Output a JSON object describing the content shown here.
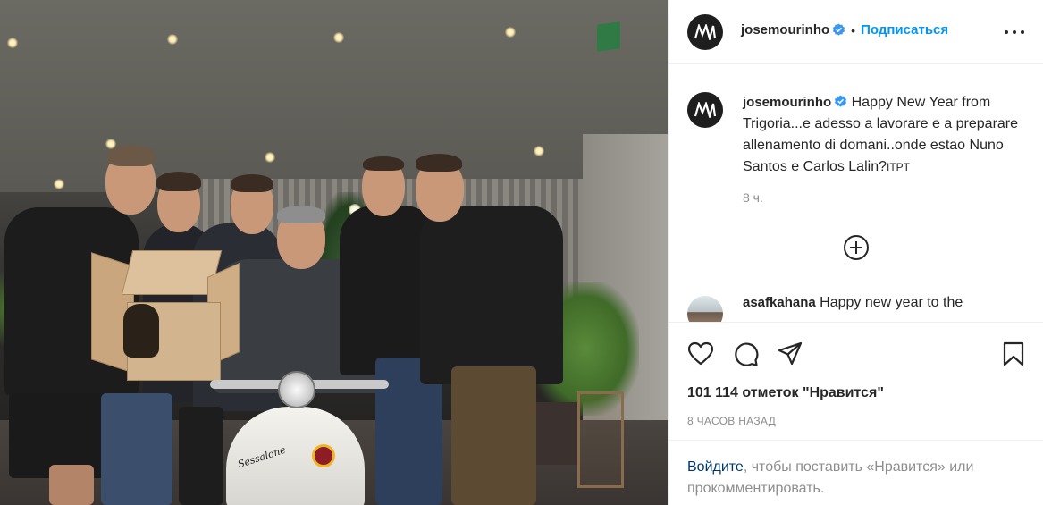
{
  "post": {
    "photo_alt": "",
    "photo_text": {
      "scooter_script": "Sessalone"
    }
  },
  "header": {
    "username": "josemourinho",
    "separator": "•",
    "follow_label": "Подписаться",
    "more_icon": "more-horizontal-icon",
    "verified_icon": "verified-badge-icon"
  },
  "caption": {
    "username": "josemourinho",
    "text": "Happy New Year from Trigoria...e adesso a lavorare e a preparare allenamento di domani..onde estao Nuno Santos e Carlos Lalin?",
    "suffix": "ITPT",
    "time": "8 ч.",
    "add_comment_icon": "plus-circle-icon"
  },
  "comments": [
    {
      "username": "asafkahana",
      "text": "Happy new year to the"
    }
  ],
  "actions": {
    "like_icon": "heart-icon",
    "comment_icon": "comment-icon",
    "share_icon": "send-icon",
    "save_icon": "bookmark-icon"
  },
  "likes_text": "101 114 отметок \"Нравится\"",
  "posted_ago": "8 ЧАСОВ НАЗАД",
  "login_prompt": {
    "link_label": "Войдите",
    "rest": ", чтобы поставить «Нравится» или прокомментировать."
  },
  "colors": {
    "accent": "#0095f6",
    "text": "#262626",
    "muted": "#8e8e8e",
    "link_dark": "#00376b",
    "verified": "#3897f0"
  }
}
